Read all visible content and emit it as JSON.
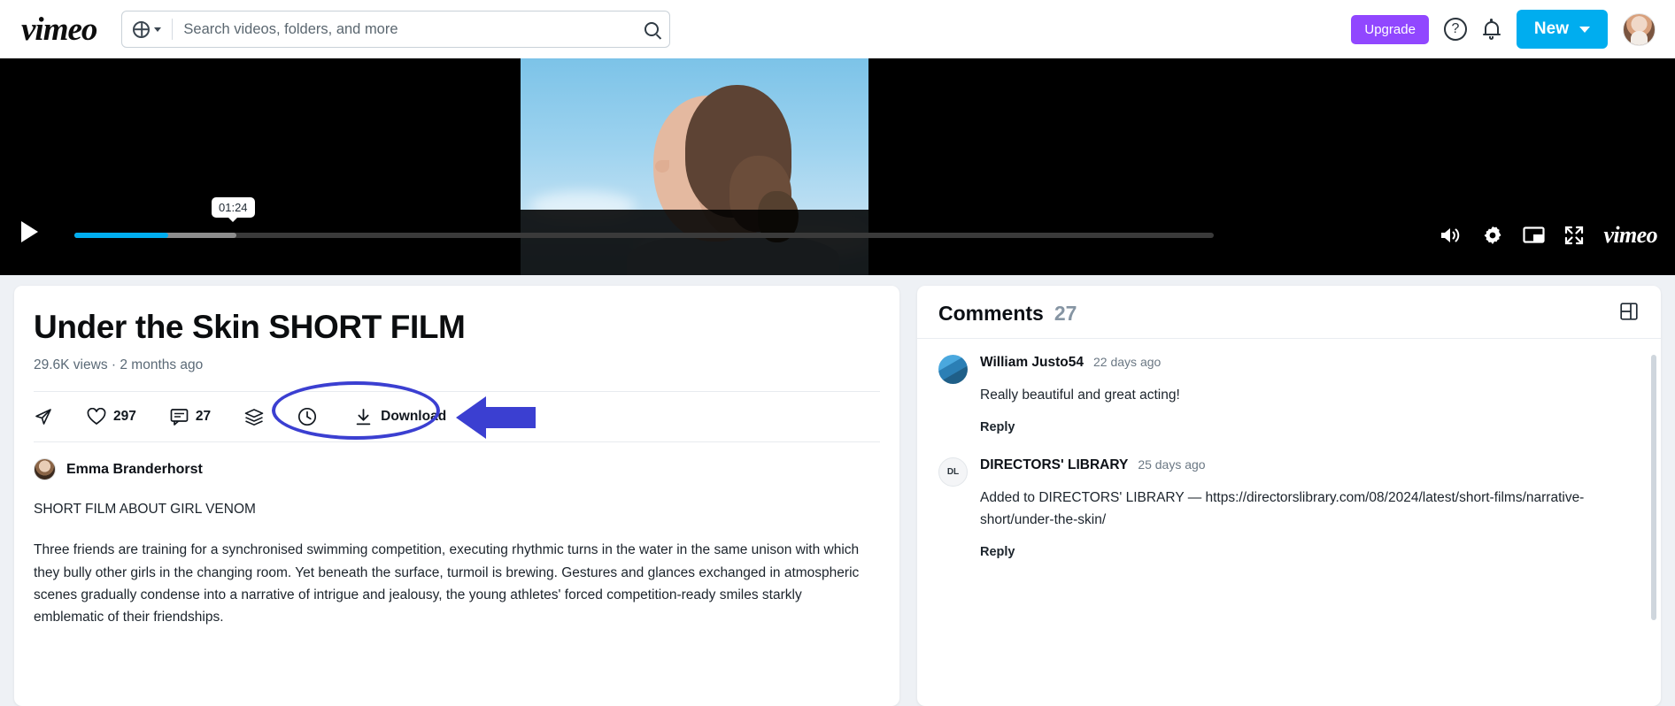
{
  "header": {
    "logo": "vimeo",
    "search": {
      "placeholder": "Search videos, folders, and more",
      "value": ""
    },
    "upgrade_label": "Upgrade",
    "new_label": "New",
    "icons": {
      "globe": "globe-icon",
      "chevron": "chevron-down-icon",
      "search": "search-icon",
      "help": "?",
      "bell": "bell-icon",
      "avatar": "avatar"
    }
  },
  "player": {
    "current_tooltip": "01:24",
    "played_percent": 8,
    "buffered_percent": 14,
    "controls": {
      "play": "play-icon",
      "volume": "volume-icon",
      "settings": "gear-icon",
      "pip": "picture-in-picture-icon",
      "fullscreen": "fullscreen-icon",
      "brand": "vimeo"
    }
  },
  "video": {
    "title": "Under the Skin SHORT FILM",
    "views": "29.6K views",
    "separator": "·",
    "age": "2 months ago",
    "actions": {
      "share": "share-icon",
      "likes": "297",
      "comments": "27",
      "collections": "collections-icon",
      "watch_later": "clock-icon",
      "download_label": "Download"
    },
    "author": "Emma Branderhorst",
    "description_heading": "SHORT FILM ABOUT GIRL VENOM",
    "description_body": "Three friends are training for a synchronised swimming competition, executing rhythmic turns in the water in the same unison with which they bully other girls in the changing room. Yet beneath the surface, turmoil is brewing. Gestures and glances exchanged in atmospheric scenes gradually condense into a narrative of intrigue and jealousy, the young athletes' forced competition-ready smiles starkly emblematic of their friendships."
  },
  "comments": {
    "title": "Comments",
    "count": "27",
    "panel_toggle": "layout-panel-icon",
    "items": [
      {
        "author": "William Justo54",
        "time": "22 days ago",
        "text": "Really beautiful and great acting!",
        "reply_label": "Reply",
        "avatar_text": ""
      },
      {
        "author": "DIRECTORS' LIBRARY",
        "time": "25 days ago",
        "text": "Added to DIRECTORS' LIBRARY — https://directorslibrary.com/08/2024/latest/short-films/narrative-short/under-the-skin/",
        "reply_label": "Reply",
        "avatar_text": "DL"
      }
    ]
  },
  "colors": {
    "brand_blue": "#00adef",
    "upgrade_purple": "#9147ff",
    "annotation": "#3b3fd1"
  }
}
